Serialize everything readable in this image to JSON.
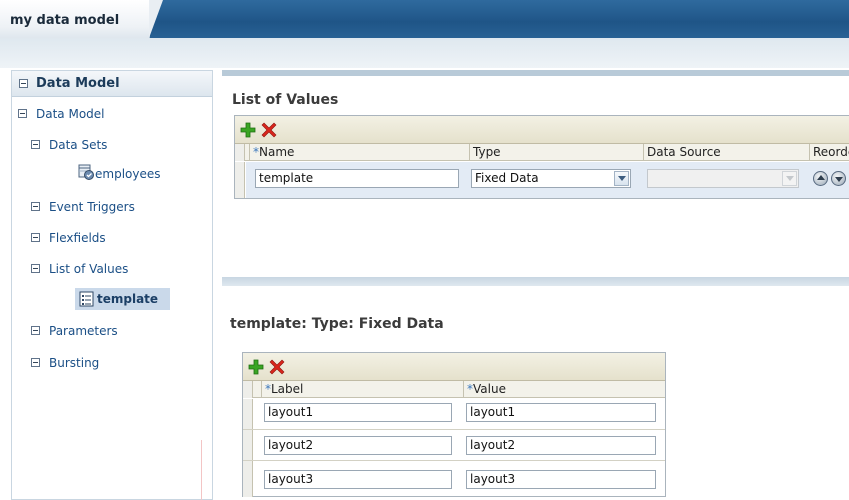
{
  "window": {
    "tab_title": "my data model"
  },
  "left_panel": {
    "header": "Data Model",
    "tree": {
      "root": "Data Model",
      "data_sets": "Data Sets",
      "dataset_employees": "employees",
      "event_triggers": "Event Triggers",
      "flexfields": "Flexfields",
      "list_of_values": "List of Values",
      "lov_template": "template",
      "parameters": "Parameters",
      "bursting": "Bursting"
    }
  },
  "lov_section": {
    "title": "List of Values",
    "columns": {
      "name": "Name",
      "type": "Type",
      "data_source": "Data Source",
      "reorder": "Reorder"
    },
    "rows": [
      {
        "name": "template",
        "type": "Fixed Data",
        "data_source": ""
      }
    ]
  },
  "fixed_data_section": {
    "title": "template: Type: Fixed Data",
    "columns": {
      "label": "Label",
      "value": "Value"
    },
    "rows": [
      {
        "label": "layout1",
        "value": "layout1"
      },
      {
        "label": "layout2",
        "value": "layout2"
      },
      {
        "label": "layout3",
        "value": "layout3"
      }
    ]
  },
  "required_marker": "*",
  "colors": {
    "accent_blue": "#1f5587",
    "link_blue": "#1b4f86",
    "add_green": "#3aa523",
    "delete_red": "#d9261c"
  }
}
